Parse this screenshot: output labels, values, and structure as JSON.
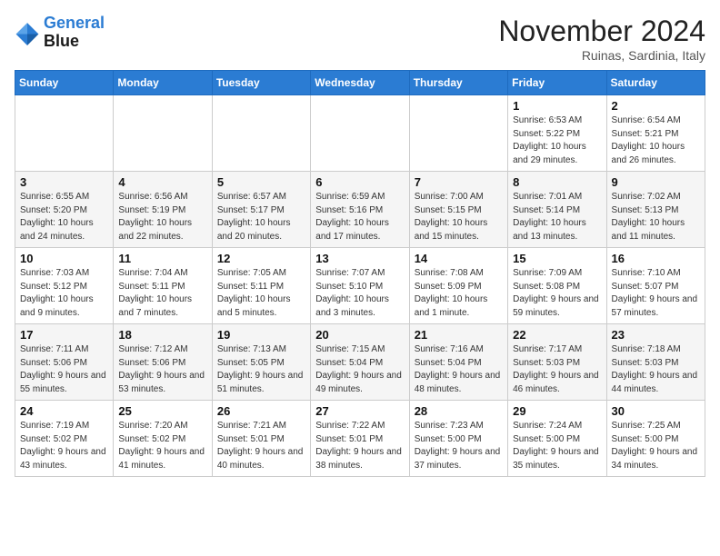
{
  "logo": {
    "line1": "General",
    "line2": "Blue"
  },
  "title": "November 2024",
  "location": "Ruinas, Sardinia, Italy",
  "headers": [
    "Sunday",
    "Monday",
    "Tuesday",
    "Wednesday",
    "Thursday",
    "Friday",
    "Saturday"
  ],
  "weeks": [
    [
      {
        "day": "",
        "info": ""
      },
      {
        "day": "",
        "info": ""
      },
      {
        "day": "",
        "info": ""
      },
      {
        "day": "",
        "info": ""
      },
      {
        "day": "",
        "info": ""
      },
      {
        "day": "1",
        "info": "Sunrise: 6:53 AM\nSunset: 5:22 PM\nDaylight: 10 hours and 29 minutes."
      },
      {
        "day": "2",
        "info": "Sunrise: 6:54 AM\nSunset: 5:21 PM\nDaylight: 10 hours and 26 minutes."
      }
    ],
    [
      {
        "day": "3",
        "info": "Sunrise: 6:55 AM\nSunset: 5:20 PM\nDaylight: 10 hours and 24 minutes."
      },
      {
        "day": "4",
        "info": "Sunrise: 6:56 AM\nSunset: 5:19 PM\nDaylight: 10 hours and 22 minutes."
      },
      {
        "day": "5",
        "info": "Sunrise: 6:57 AM\nSunset: 5:17 PM\nDaylight: 10 hours and 20 minutes."
      },
      {
        "day": "6",
        "info": "Sunrise: 6:59 AM\nSunset: 5:16 PM\nDaylight: 10 hours and 17 minutes."
      },
      {
        "day": "7",
        "info": "Sunrise: 7:00 AM\nSunset: 5:15 PM\nDaylight: 10 hours and 15 minutes."
      },
      {
        "day": "8",
        "info": "Sunrise: 7:01 AM\nSunset: 5:14 PM\nDaylight: 10 hours and 13 minutes."
      },
      {
        "day": "9",
        "info": "Sunrise: 7:02 AM\nSunset: 5:13 PM\nDaylight: 10 hours and 11 minutes."
      }
    ],
    [
      {
        "day": "10",
        "info": "Sunrise: 7:03 AM\nSunset: 5:12 PM\nDaylight: 10 hours and 9 minutes."
      },
      {
        "day": "11",
        "info": "Sunrise: 7:04 AM\nSunset: 5:11 PM\nDaylight: 10 hours and 7 minutes."
      },
      {
        "day": "12",
        "info": "Sunrise: 7:05 AM\nSunset: 5:11 PM\nDaylight: 10 hours and 5 minutes."
      },
      {
        "day": "13",
        "info": "Sunrise: 7:07 AM\nSunset: 5:10 PM\nDaylight: 10 hours and 3 minutes."
      },
      {
        "day": "14",
        "info": "Sunrise: 7:08 AM\nSunset: 5:09 PM\nDaylight: 10 hours and 1 minute."
      },
      {
        "day": "15",
        "info": "Sunrise: 7:09 AM\nSunset: 5:08 PM\nDaylight: 9 hours and 59 minutes."
      },
      {
        "day": "16",
        "info": "Sunrise: 7:10 AM\nSunset: 5:07 PM\nDaylight: 9 hours and 57 minutes."
      }
    ],
    [
      {
        "day": "17",
        "info": "Sunrise: 7:11 AM\nSunset: 5:06 PM\nDaylight: 9 hours and 55 minutes."
      },
      {
        "day": "18",
        "info": "Sunrise: 7:12 AM\nSunset: 5:06 PM\nDaylight: 9 hours and 53 minutes."
      },
      {
        "day": "19",
        "info": "Sunrise: 7:13 AM\nSunset: 5:05 PM\nDaylight: 9 hours and 51 minutes."
      },
      {
        "day": "20",
        "info": "Sunrise: 7:15 AM\nSunset: 5:04 PM\nDaylight: 9 hours and 49 minutes."
      },
      {
        "day": "21",
        "info": "Sunrise: 7:16 AM\nSunset: 5:04 PM\nDaylight: 9 hours and 48 minutes."
      },
      {
        "day": "22",
        "info": "Sunrise: 7:17 AM\nSunset: 5:03 PM\nDaylight: 9 hours and 46 minutes."
      },
      {
        "day": "23",
        "info": "Sunrise: 7:18 AM\nSunset: 5:03 PM\nDaylight: 9 hours and 44 minutes."
      }
    ],
    [
      {
        "day": "24",
        "info": "Sunrise: 7:19 AM\nSunset: 5:02 PM\nDaylight: 9 hours and 43 minutes."
      },
      {
        "day": "25",
        "info": "Sunrise: 7:20 AM\nSunset: 5:02 PM\nDaylight: 9 hours and 41 minutes."
      },
      {
        "day": "26",
        "info": "Sunrise: 7:21 AM\nSunset: 5:01 PM\nDaylight: 9 hours and 40 minutes."
      },
      {
        "day": "27",
        "info": "Sunrise: 7:22 AM\nSunset: 5:01 PM\nDaylight: 9 hours and 38 minutes."
      },
      {
        "day": "28",
        "info": "Sunrise: 7:23 AM\nSunset: 5:00 PM\nDaylight: 9 hours and 37 minutes."
      },
      {
        "day": "29",
        "info": "Sunrise: 7:24 AM\nSunset: 5:00 PM\nDaylight: 9 hours and 35 minutes."
      },
      {
        "day": "30",
        "info": "Sunrise: 7:25 AM\nSunset: 5:00 PM\nDaylight: 9 hours and 34 minutes."
      }
    ]
  ]
}
